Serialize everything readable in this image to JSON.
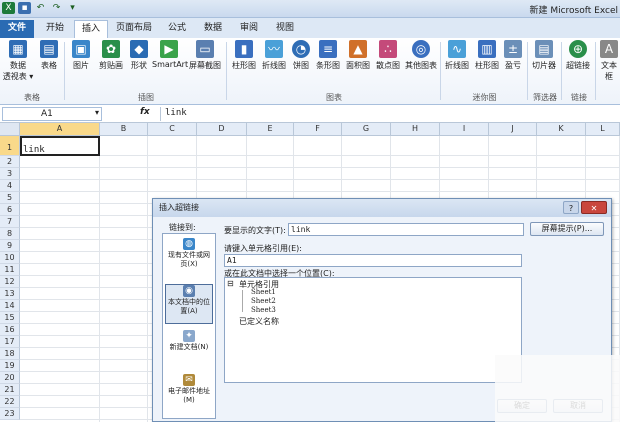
{
  "app": {
    "title": "新建 Microsoft Excel"
  },
  "tabs": [
    {
      "label": "文件"
    },
    {
      "label": "开始"
    },
    {
      "label": "插入"
    },
    {
      "label": "页面布局"
    },
    {
      "label": "公式"
    },
    {
      "label": "数据"
    },
    {
      "label": "审阅"
    },
    {
      "label": "视图"
    }
  ],
  "ribbon": {
    "buttons": [
      {
        "label": "数据\n透视表 ▾",
        "icon": "pivot-table-icon",
        "color": "#2f6db5"
      },
      {
        "label": "表格",
        "icon": "table-icon",
        "color": "#2f6db5"
      },
      {
        "label": "图片",
        "icon": "picture-icon",
        "color": "#3a86c9"
      },
      {
        "label": "剪贴画",
        "icon": "clipart-icon",
        "color": "#2a8f4a"
      },
      {
        "label": "形状",
        "icon": "shapes-icon",
        "color": "#2a6bb3"
      },
      {
        "label": "SmartArt",
        "icon": "smartart-icon",
        "color": "#3aa34a"
      },
      {
        "label": "屏幕截图",
        "icon": "screenshot-icon",
        "color": "#5a7fb0"
      },
      {
        "label": "柱形图",
        "icon": "column-chart-icon",
        "color": "#3a6fbf"
      },
      {
        "label": "折线图",
        "icon": "line-chart-icon",
        "color": "#4aa0d8"
      },
      {
        "label": "饼图",
        "icon": "pie-chart-icon",
        "color": "#2f6db5"
      },
      {
        "label": "条形图",
        "icon": "bar-chart-icon",
        "color": "#3a6fbf"
      },
      {
        "label": "面积图",
        "icon": "area-chart-icon",
        "color": "#d0702a"
      },
      {
        "label": "散点图",
        "icon": "scatter-chart-icon",
        "color": "#c44a7a"
      },
      {
        "label": "其他图表",
        "icon": "other-chart-icon",
        "color": "#3a6fbf"
      },
      {
        "label": "折线图",
        "icon": "sparkline-line-icon",
        "color": "#4aa0d8"
      },
      {
        "label": "柱形图",
        "icon": "sparkline-column-icon",
        "color": "#3a6fbf"
      },
      {
        "label": "盈亏",
        "icon": "sparkline-winloss-icon",
        "color": "#6b8fb8"
      },
      {
        "label": "切片器",
        "icon": "slicer-icon",
        "color": "#6b8fb8"
      },
      {
        "label": "超链接",
        "icon": "hyperlink-icon",
        "color": "#2a8f4a"
      },
      {
        "label": "文本框",
        "icon": "textbox-icon",
        "color": "#888"
      }
    ],
    "groups": [
      {
        "label": "表格"
      },
      {
        "label": "插图"
      },
      {
        "label": "图表"
      },
      {
        "label": "迷你图"
      },
      {
        "label": "筛选器"
      },
      {
        "label": "链接"
      }
    ]
  },
  "formula": {
    "namebox": "A1",
    "fx": "fx",
    "value": "link"
  },
  "grid": {
    "columns": [
      "A",
      "B",
      "C",
      "D",
      "E",
      "F",
      "G",
      "H",
      "I",
      "J",
      "K",
      "L"
    ],
    "rows": [
      "1",
      "2",
      "3",
      "4",
      "5",
      "6",
      "7",
      "8",
      "9",
      "10",
      "11",
      "12",
      "13",
      "14",
      "15",
      "16",
      "17",
      "18",
      "19",
      "20",
      "21",
      "22",
      "23"
    ],
    "a1_value": "link",
    "selected_col": "A",
    "selected_row": "1"
  },
  "dialog": {
    "title": "插入超链接",
    "help": "?",
    "close": "✕",
    "link_to_label": "链接到:",
    "left_items": [
      {
        "label": "现有文件或网页(X)",
        "icon": "globe-file-icon"
      },
      {
        "label": "本文档中的位置(A)",
        "icon": "document-place-icon"
      },
      {
        "label": "新建文档(N)",
        "icon": "new-document-icon"
      },
      {
        "label": "电子邮件地址(M)",
        "icon": "email-icon"
      }
    ],
    "display_label": "要显示的文字(T):",
    "display_value": "link",
    "screentip_button": "屏幕提示(P)...",
    "cellref_label": "请键入单元格引用(E):",
    "cellref_value": "A1",
    "location_label": "或在此文档中选择一个位置(C):",
    "tree": {
      "root": "单元格引用",
      "sheets": [
        "Sheet1",
        "Sheet2",
        "Sheet3"
      ],
      "names": "已定义名称"
    },
    "ok": "确定",
    "cancel": "取消"
  }
}
